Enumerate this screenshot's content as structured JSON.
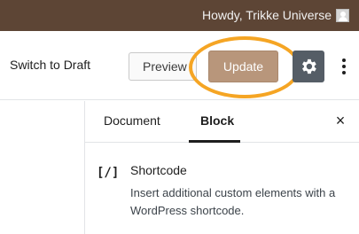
{
  "admin_bar": {
    "greeting": "Howdy, Trikke Universe",
    "avatar_icon": "user-avatar-icon"
  },
  "toolbar": {
    "switch_to_draft_label": "Switch to Draft",
    "preview_label": "Preview",
    "update_label": "Update",
    "update_color": "#b8967b",
    "highlight_color": "#f5a524",
    "settings_icon": "gear-icon",
    "more_icon": "more-vertical-icon"
  },
  "sidebar": {
    "tabs": [
      {
        "label": "Document",
        "active": false
      },
      {
        "label": "Block",
        "active": true
      }
    ],
    "close_label": "×",
    "block": {
      "icon_glyph": "[/]",
      "name": "Shortcode",
      "description": "Insert additional custom elements with a WordPress shortcode."
    }
  }
}
